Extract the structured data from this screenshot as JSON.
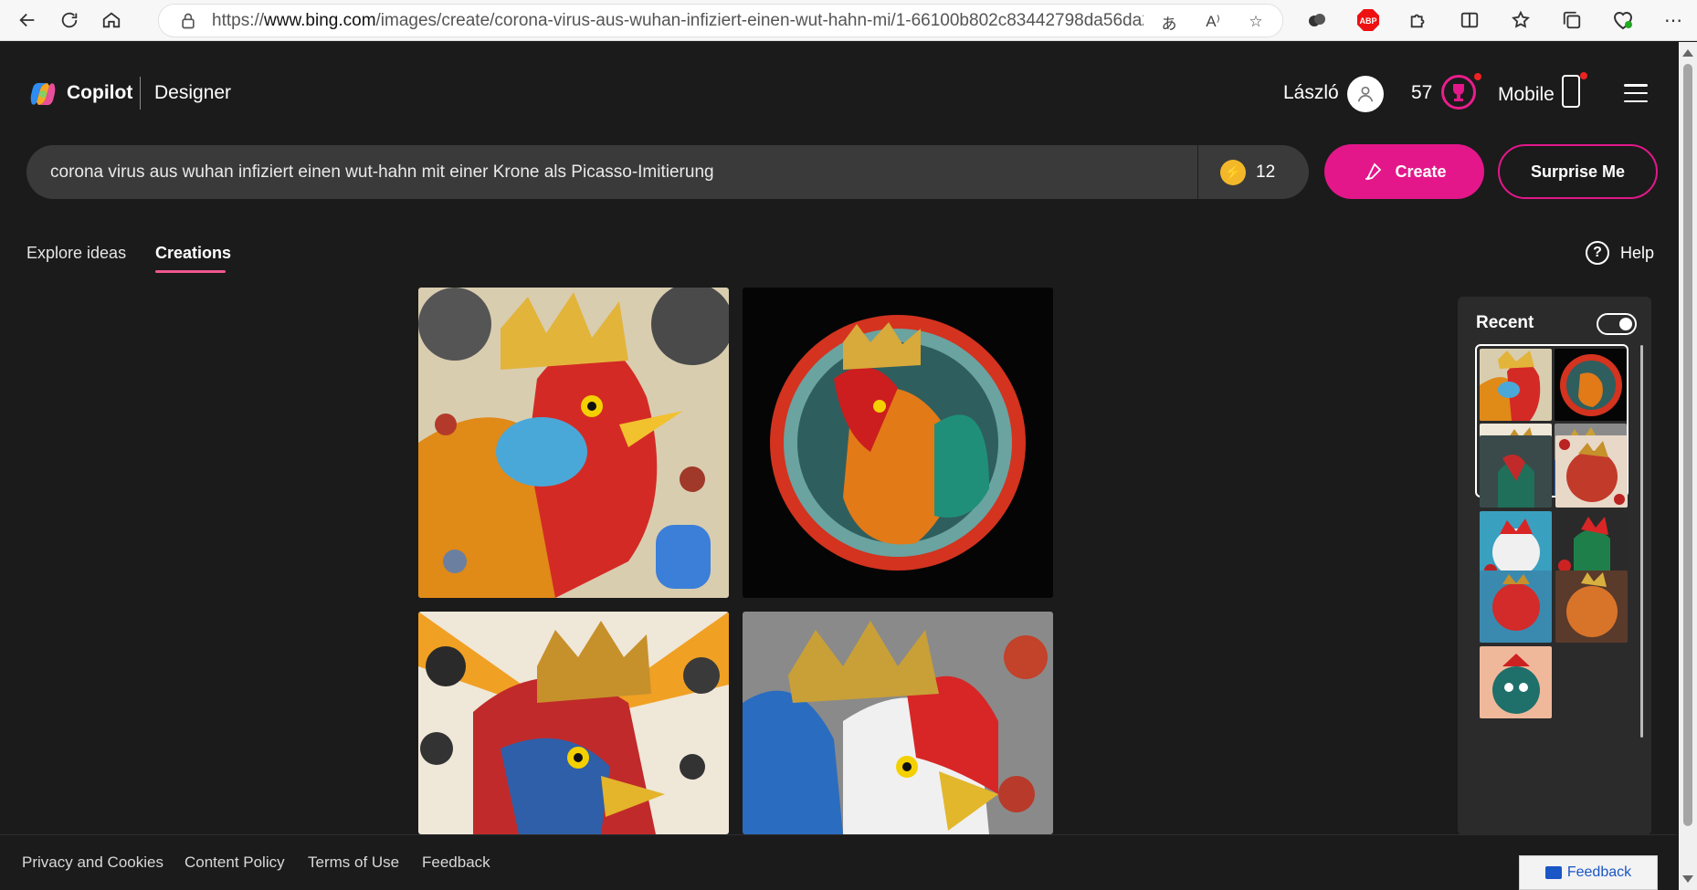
{
  "browser": {
    "url_prefix": "https://",
    "url_domain": "www.bing.com",
    "url_path": "/images/create/corona-virus-aus-wuhan-infiziert-einen-wut-hahn-mi/1-66100b802c83442798da56da28b10..."
  },
  "header": {
    "brand": "Copilot",
    "product": "Designer",
    "user_name": "László",
    "points": "57",
    "mobile_label": "Mobile"
  },
  "prompt": {
    "text": "corona virus aus wuhan infiziert einen wut-hahn mit einer Krone als Picasso-Imitierung",
    "boosts": "12",
    "create_label": "Create",
    "surprise_label": "Surprise Me"
  },
  "tabs": {
    "explore": "Explore ideas",
    "creations": "Creations",
    "help": "Help"
  },
  "recent": {
    "title": "Recent"
  },
  "footer": {
    "privacy": "Privacy and Cookies",
    "content_policy": "Content Policy",
    "terms": "Terms of Use",
    "feedback": "Feedback",
    "feedback_button": "Feedback"
  },
  "colors": {
    "accent": "#e3178a",
    "background": "#1b1b1b",
    "tab_underline": "#f0568f"
  }
}
